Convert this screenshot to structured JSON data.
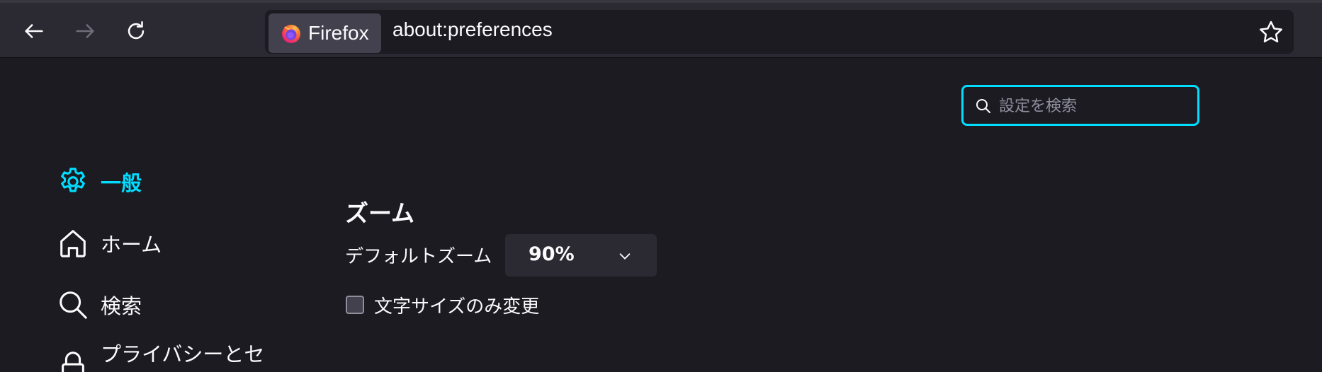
{
  "toolbar": {
    "back_icon": "back-arrow-icon",
    "forward_icon": "forward-arrow-icon",
    "reload_icon": "reload-icon",
    "identity_label": "Firefox",
    "url": "about:preferences",
    "bookmark_icon": "star-icon"
  },
  "search": {
    "placeholder": "設定を検索",
    "icon": "search-icon",
    "accent_color": "#00ddff"
  },
  "sidebar": {
    "items": [
      {
        "label": "一般",
        "icon": "gear-icon",
        "active": true
      },
      {
        "label": "ホーム",
        "icon": "home-icon",
        "active": false
      },
      {
        "label": "検索",
        "icon": "search-icon",
        "active": false
      },
      {
        "label": "プライバシーとセ",
        "icon": "lock-icon",
        "active": false
      }
    ]
  },
  "main": {
    "section_title": "ズーム",
    "default_zoom_label": "デフォルトズーム",
    "default_zoom_value": "90%",
    "text_only_label": "文字サイズのみ変更",
    "text_only_checked": false
  },
  "colors": {
    "background": "#1c1b22",
    "toolbar": "#2b2a33",
    "accent": "#00ddff",
    "text": "#fbfbfe"
  }
}
